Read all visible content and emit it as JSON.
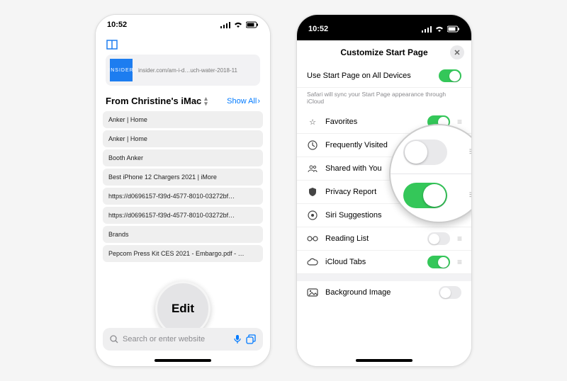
{
  "status_time": "10:52",
  "left": {
    "insider": {
      "badge": "INSIDER",
      "caption": "insider.com/am-i-d…uch-water-2018-11"
    },
    "section_title": "From Christine's iMac",
    "show_all": "Show All",
    "tabs": [
      "Anker | Home",
      "Anker | Home",
      "Booth Anker",
      "Best iPhone 12 Chargers 2021 | iMore",
      "https://d0696157-f39d-4577-8010-03272bf…",
      "https://d0696157-f39d-4577-8010-03272bf…",
      "Brands",
      "Pepcom Press Kit CES 2021 - Embargo.pdf - …"
    ],
    "url_placeholder": "Search or enter website",
    "edit_label": "Edit"
  },
  "right": {
    "sheet_title": "Customize Start Page",
    "sync_row": {
      "label": "Use Start Page on All Devices",
      "on": true
    },
    "sync_note": "Safari will sync your Start Page appearance through iCloud",
    "rows": [
      {
        "icon": "star",
        "label": "Favorites",
        "on": true,
        "grip": true
      },
      {
        "icon": "clock",
        "label": "Frequently Visited",
        "on": true,
        "grip": true
      },
      {
        "icon": "people",
        "label": "Shared with You",
        "on": true,
        "grip": true
      },
      {
        "icon": "shield",
        "label": "Privacy Report",
        "on": true,
        "grip": true
      },
      {
        "icon": "siri",
        "label": "Siri Suggestions",
        "on": true,
        "grip": true
      },
      {
        "icon": "glasses",
        "label": "Reading List",
        "on": false,
        "grip": true
      },
      {
        "icon": "cloud",
        "label": "iCloud Tabs",
        "on": true,
        "grip": true
      }
    ],
    "bg_row": {
      "label": "Background Image",
      "on": false
    }
  }
}
